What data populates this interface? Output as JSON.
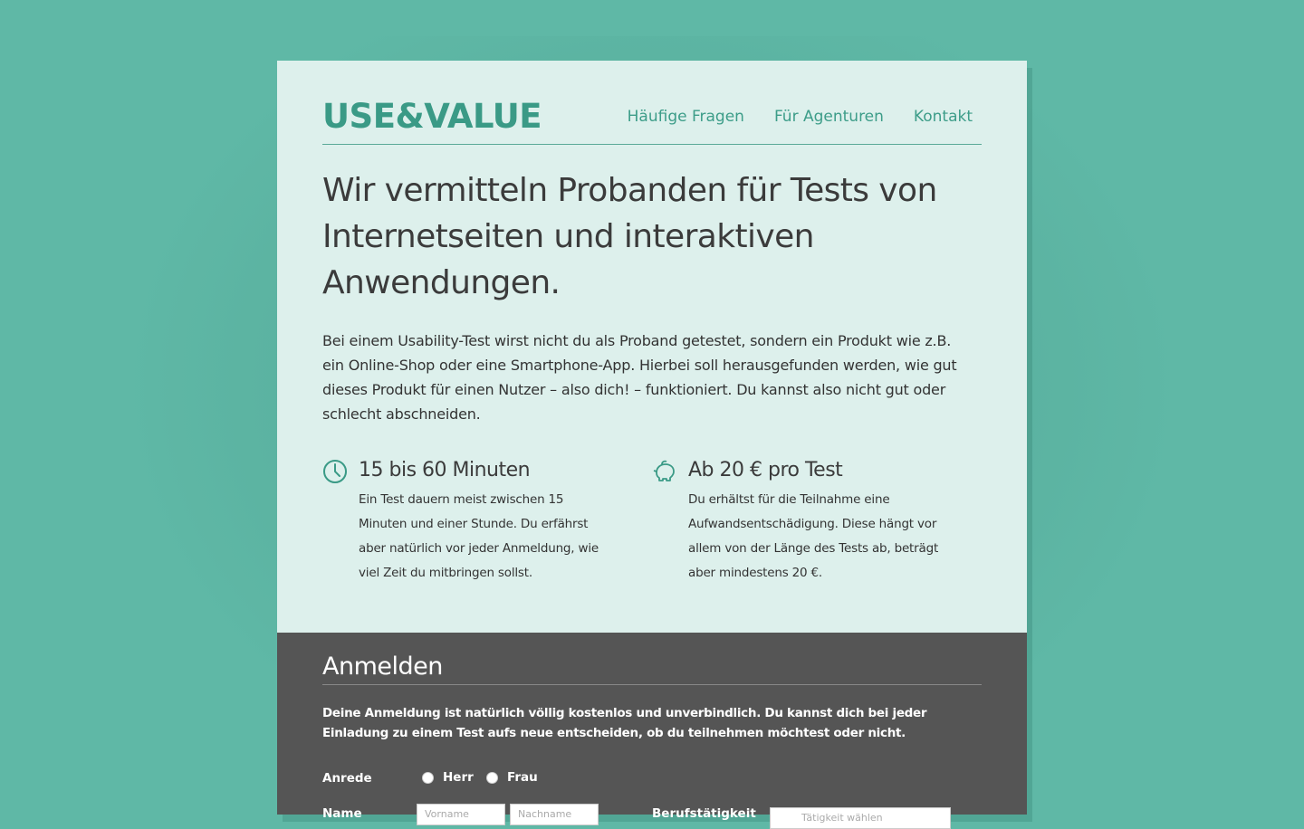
{
  "brand": {
    "logo": "USE&VALUE",
    "accent": "#3a9a86",
    "background": "#5fb8a6"
  },
  "nav": {
    "items": [
      {
        "label": "Häufige Fragen"
      },
      {
        "label": "Für Agenturen"
      },
      {
        "label": "Kontakt"
      }
    ]
  },
  "hero": {
    "headline": "Wir vermitteln Probanden für Tests von Internetseiten und interaktiven Anwendungen.",
    "intro": "Bei einem Usability-Test wirst nicht du als Proband getestet, sondern ein Produkt wie z.B. ein Online-Shop oder eine Smartphone-App. Hierbei soll herausgefunden werden, wie gut dieses Produkt für einen Nutzer – also dich! – funktioniert. Du kannst also nicht gut oder schlecht abschneiden."
  },
  "features": [
    {
      "icon": "clock-icon",
      "title": "15 bis 60 Minuten",
      "text": "Ein Test dauern meist zwischen 15 Minuten und einer Stunde. Du erfährst aber natürlich vor jeder Anmeldung, wie viel Zeit du mitbringen sollst."
    },
    {
      "icon": "piggy-bank-icon",
      "title": "Ab 20 € pro Test",
      "text": "Du erhältst für die Teilnahme eine Aufwandsentschädigung. Diese hängt vor allem von der Länge des Tests ab, beträgt aber mindestens 20 €."
    }
  ],
  "signup": {
    "title": "Anmelden",
    "note": "Deine Anmeldung ist natürlich völlig kostenlos und unverbindlich. Du kannst dich bei jeder Einladung zu einem Test aufs neue entscheiden, ob du teilnehmen möchtest oder nicht.",
    "salutation_label": "Anrede",
    "salutation_options": [
      "Herr",
      "Frau"
    ],
    "name_label": "Name",
    "firstname_placeholder": "Vorname",
    "lastname_placeholder": "Nachname",
    "job_label": "Berufstätigkeit",
    "job_value": "Tätigkeit wählen"
  }
}
